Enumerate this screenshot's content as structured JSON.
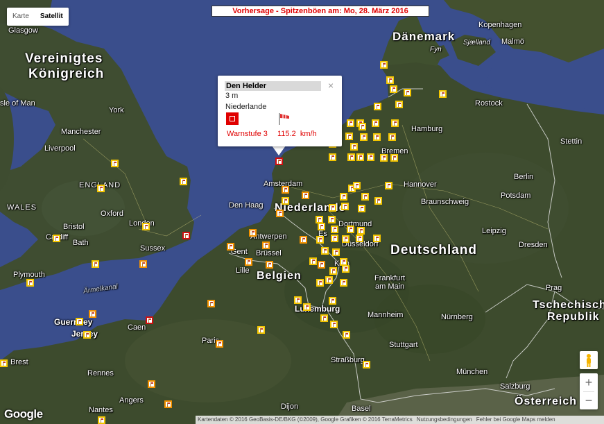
{
  "maptype": {
    "karte": "Karte",
    "satellit": "Satellit"
  },
  "headline": "Vorhersage - Spitzenböen am: Mo, 28. März 2016",
  "popup": {
    "title": "Den Helder",
    "close": "×",
    "altitude": "3 m",
    "country": "Niederlande",
    "warnlevel": "Warnstufe 3",
    "gust": "115.2  km/h"
  },
  "labels": {
    "vereinigtes": "Vereinigtes",
    "koenigreich": "Königreich",
    "danemark": "Dänemark",
    "deutschland": "Deutschland",
    "niederlande": "Niederlande",
    "belgien": "Belgien",
    "luxemburg": "Luxemburg",
    "tschech1": "Tschechisch",
    "tschech2": "Republik",
    "osterreich": "Österreich",
    "england": "ENGLAND",
    "wales": "WALES",
    "glasgow": "Glasgow",
    "isle_of_man": "sle of Man",
    "york": "York",
    "manchester": "Manchester",
    "liverpool": "Liverpool",
    "oxford": "Oxford",
    "london": "London",
    "bristol": "Bristol",
    "cardiff": "Cardiff",
    "bath": "Bath",
    "plymouth": "Plymouth",
    "sussex": "Sussex",
    "aermelkanal": "Ärmelkanal",
    "guernsey": "Guernsey",
    "jersey": "Jersey",
    "caen": "Caen",
    "brest": "Brest",
    "rennes": "Rennes",
    "angers": "Angers",
    "nantes": "Nantes",
    "paris": "Paris",
    "dijon": "Dijon",
    "basel": "Basel",
    "strassburg": "Straßburg",
    "lille": "Lille",
    "gent": "Gent",
    "brussel": "Brüssel",
    "antwerpen": "Antwerpen",
    "den_haag": "Den Haag",
    "amsterdam": "Amsterdam",
    "kopenhagen": "Kopenhagen",
    "malmo": "Malmö",
    "sjaelland": "Sjælland",
    "fyn": "Fyn",
    "rostock": "Rostock",
    "hamburg": "Hamburg",
    "bremen": "Bremen",
    "stettin": "Stettin",
    "berlin": "Berlin",
    "hannover": "Hannover",
    "potsdam": "Potsdam",
    "braunschweig": "Braunschweig",
    "dortmund": "Dortmund",
    "essen": "Es",
    "dusseldorf": "Düsseldorf",
    "koln": "Köln",
    "leipzig": "Leipzig",
    "dresden": "Dresden",
    "frankfurt1": "Frankfurt",
    "frankfurt2": "am Main",
    "mannheim": "Mannheim",
    "nurnberg": "Nürnberg",
    "stuttgart": "Stuttgart",
    "munchen": "München",
    "prag": "Prag",
    "salzburg": "Salzburg"
  },
  "controls": {
    "zoom_in": "+",
    "zoom_out": "−"
  },
  "logo": "Google",
  "footer": {
    "attribution": "Kartendaten © 2016 GeoBasis-DE/BKG (©2009), Google Grafiken © 2016 TerraMetrics",
    "terms": "Nutzungsbedingungen",
    "report": "Fehler bei Google Maps melden"
  },
  "colors": {
    "marker_yellow": "#f2c400",
    "marker_orange": "#f39200",
    "marker_red": "#d01010",
    "warning_red": "#e00000",
    "sea": "#3a4e8c",
    "land": "#3b4a2e"
  }
}
